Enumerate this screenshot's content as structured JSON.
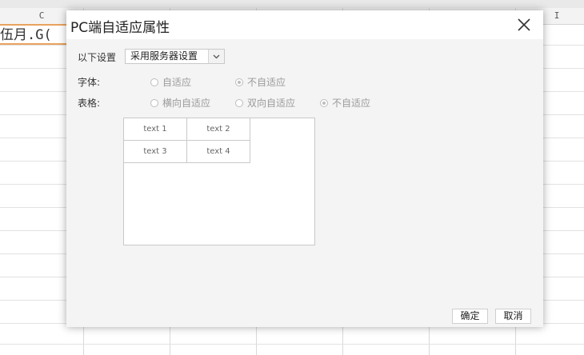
{
  "sheet": {
    "column_headers": [
      {
        "letter": "C"
      },
      {
        "letter": "I"
      }
    ],
    "cell_text": "伍月.G("
  },
  "dialog": {
    "title": "PC端自适应属性",
    "settings_label": "以下设置",
    "settings_select": {
      "value": "采用服务器设置"
    },
    "font_row": {
      "label": "字体:",
      "options": [
        {
          "label": "自适应",
          "checked": false
        },
        {
          "label": "不自适应",
          "checked": true
        }
      ]
    },
    "table_row": {
      "label": "表格:",
      "options": [
        {
          "label": "横向自适应",
          "checked": false
        },
        {
          "label": "双向自适应",
          "checked": false
        },
        {
          "label": "不自适应",
          "checked": true
        }
      ]
    },
    "preview": {
      "cells": [
        "text 1",
        "text 2",
        "text 3",
        "text 4"
      ]
    },
    "buttons": {
      "confirm": "确定",
      "cancel": "取消"
    }
  }
}
